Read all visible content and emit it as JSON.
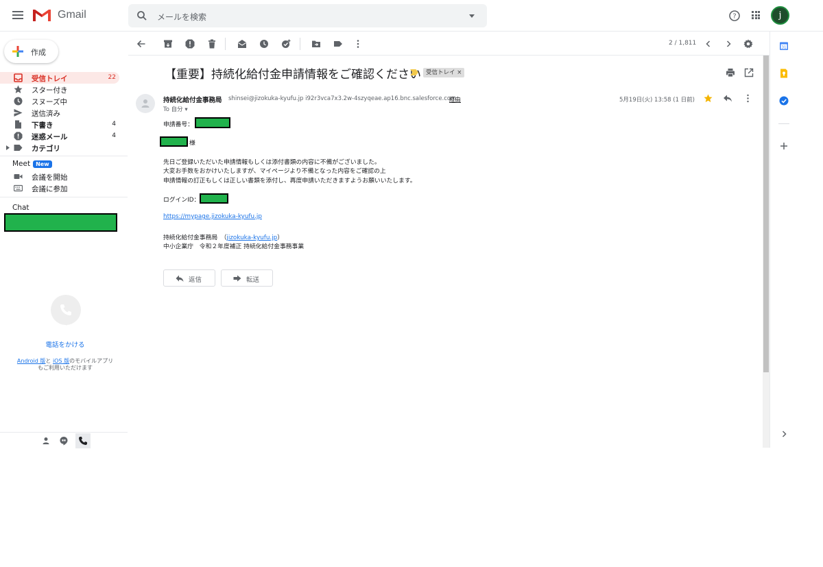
{
  "header": {
    "app_name": "Gmail",
    "search_placeholder": "メールを検索",
    "avatar_letter": "j"
  },
  "sidebar": {
    "compose_label": "作成",
    "items": [
      {
        "label": "受信トレイ",
        "count": "22",
        "icon": "inbox-icon",
        "active": true
      },
      {
        "label": "スター付き",
        "count": "",
        "icon": "star-icon"
      },
      {
        "label": "スヌーズ中",
        "count": "",
        "icon": "clock-icon"
      },
      {
        "label": "送信済み",
        "count": "",
        "icon": "send-icon"
      },
      {
        "label": "下書き",
        "count": "4",
        "icon": "draft-icon"
      },
      {
        "label": "迷惑メール",
        "count": "4",
        "icon": "spam-icon"
      },
      {
        "label": "カテゴリ",
        "count": "",
        "icon": "label-icon"
      }
    ],
    "meet": {
      "title": "Meet",
      "badge": "New",
      "items": [
        {
          "label": "会議を開始",
          "icon": "video-icon"
        },
        {
          "label": "会議に参加",
          "icon": "keyboard-icon"
        }
      ]
    },
    "chat_title": "Chat",
    "call_link": "電話をかける",
    "app_note_android": "Android 版",
    "app_note_and": "と",
    "app_note_ios": "iOS 版",
    "app_note_rest": "のモバイルアプリ",
    "app_note_line2": "もご利用いただけます"
  },
  "toolbar": {
    "pager": "2 / 1,811"
  },
  "message": {
    "subject": "【重要】持続化給付金申請情報をご確認ください",
    "label_chip": "受信トレイ ×",
    "sender_name": "持続化給付金事務局",
    "sender_email": "shinsei@jizokuka-kyufu.jp i92r3vca7x3.2w-4szyqeae.ap16.bnc.salesforce.com",
    "via": "経由",
    "to": "To 自分 ▾",
    "date": "5月19日(火) 13:58 (1 日前)",
    "body": {
      "app_number_label": "申請番号：",
      "salutation": "様",
      "para1": "先日ご登録いただいた申請情報もしくは添付書類の内容に不備がございました。",
      "para2": "大変お手数をおかけいたしますが、マイページより不備となった内容をご確認の上",
      "para3": "申請情報の訂正もしくは正しい書類を添付し、再度申請いただきますようお願いいたします。",
      "login_label": "ログインID：",
      "mypage_link": "https://mypage.jizokuka-kyufu.jp",
      "office_prefix": "持続化給付金事務局　（",
      "office_link": "jizokuka-kyufu.jp",
      "office_suffix": "）",
      "office_line2": "中小企業庁　令和２年度補正 持続化給付金事務事業"
    },
    "reply_label": "返信",
    "forward_label": "転送"
  }
}
